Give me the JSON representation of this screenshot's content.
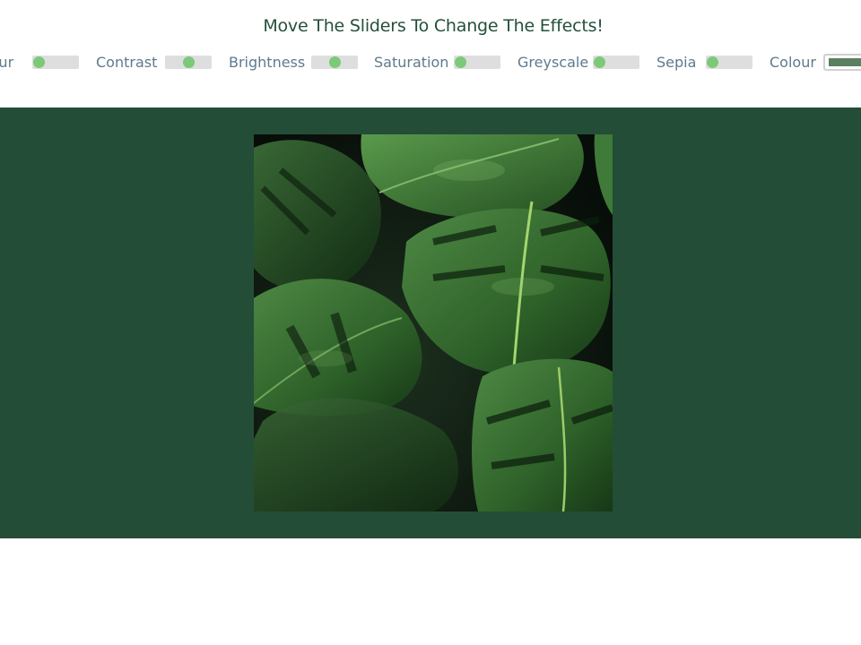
{
  "header": {
    "title": "Move The Sliders To Change The Effects!"
  },
  "controls": [
    {
      "label": "Blur",
      "value": 0.12
    },
    {
      "label": "Contrast",
      "value": 0.5
    },
    {
      "label": "Brightness",
      "value": 0.5
    },
    {
      "label": "Saturation",
      "value": 0.12
    },
    {
      "label": "Greyscale",
      "value": 0.12
    },
    {
      "label": "Sepia",
      "value": 0.12
    },
    {
      "label": "Colour",
      "value": "#5a8060"
    }
  ],
  "colors": {
    "stage_bg": "#244d38",
    "title": "#24503a",
    "label": "#5e7a8c",
    "knob": "#7cc979",
    "track": "#dedede"
  },
  "image": {
    "subject": "monstera leaves photo"
  }
}
